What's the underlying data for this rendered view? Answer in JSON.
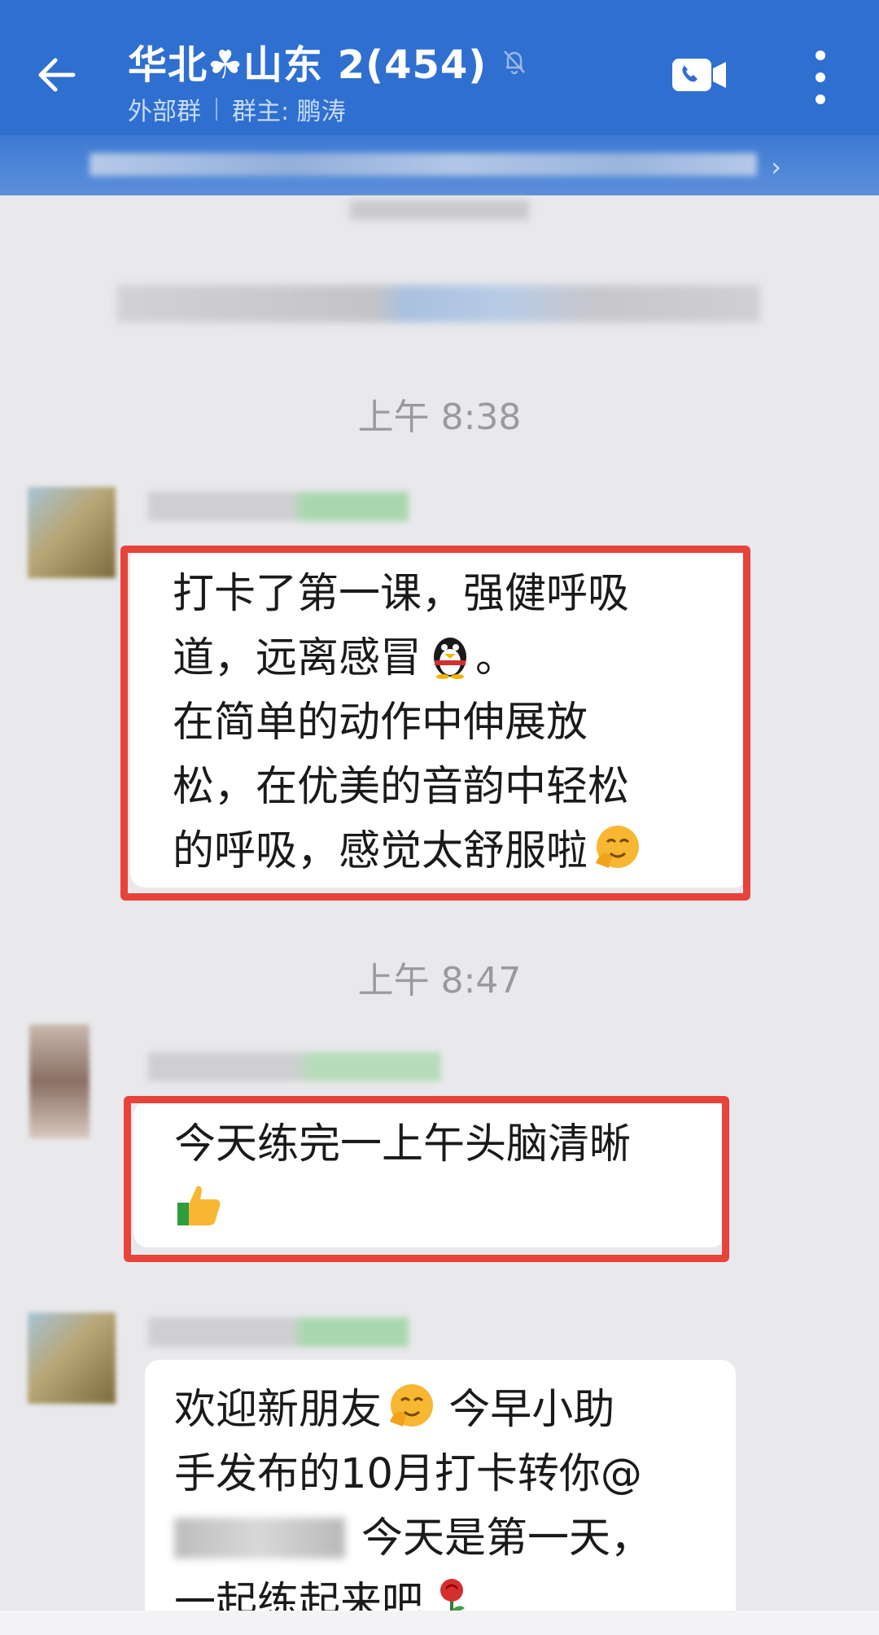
{
  "header": {
    "title": "华北☘山东 2(454)",
    "tag": "外部群",
    "owner": "群主: 鹏涛",
    "background": "#2f6fd0"
  },
  "pinned": {
    "chevron": "›"
  },
  "timestamps": [
    "上午 8:38",
    "上午 8:47"
  ],
  "messages": [
    {
      "lines": [
        "打卡了第一课，强健呼吸",
        "道，远离感冒",
        "在简单的动作中伸展放",
        "松，在优美的音韵中轻松",
        "的呼吸，感觉太舒服啦"
      ],
      "period": "。",
      "highlighted": true
    },
    {
      "lines": [
        "今天练完一上午头脑清晰"
      ],
      "highlighted": true
    },
    {
      "lines": [
        "欢迎新朋友",
        "今早小助",
        "手发布的10月打卡转你@",
        "今天是第一天，",
        "一起练起来吧"
      ],
      "highlighted": false
    }
  ],
  "icons": [
    "back-arrow-icon",
    "mute-bell-icon",
    "video-call-icon",
    "more-vertical-icon",
    "penguin-emoji",
    "smile-hug-emoji",
    "thumbs-up-emoji",
    "rose-emoji"
  ],
  "colors": {
    "highlight": "#e8433a",
    "chat_bg": "#e9e9ec",
    "bubble": "#ffffff"
  }
}
